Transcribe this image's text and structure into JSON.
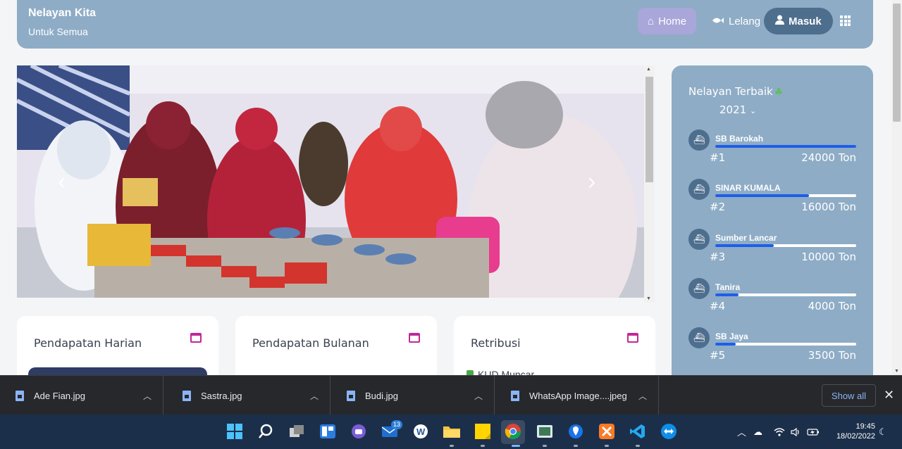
{
  "navbar": {
    "brand": "Nelayan Kita",
    "tagline": "Untuk Semua",
    "home": "Home",
    "lelang": "Lelang",
    "masuk": "Masuk"
  },
  "cards": [
    {
      "title": "Pendapatan Harian"
    },
    {
      "title": "Pendapatan Bulanan"
    },
    {
      "title": "Retribusi",
      "first_item": "KUD Muncar"
    }
  ],
  "ranking": {
    "title": "Nelayan Terbaik",
    "year": "2021",
    "items": [
      {
        "name": "SB Barokah",
        "rank": "#1",
        "value": "24000 Ton",
        "fraction": 1.0
      },
      {
        "name": "SINAR KUMALA",
        "rank": "#2",
        "value": "16000 Ton",
        "fraction": 0.667
      },
      {
        "name": "Sumber Lancar",
        "rank": "#3",
        "value": "10000 Ton",
        "fraction": 0.417
      },
      {
        "name": "Tanira",
        "rank": "#4",
        "value": "4000 Ton",
        "fraction": 0.167
      },
      {
        "name": "SB Jaya",
        "rank": "#5",
        "value": "3500 Ton",
        "fraction": 0.146
      }
    ]
  },
  "downloads": {
    "files": [
      "Ade Fian.jpg",
      "Sastra.jpg",
      "Budi.jpg",
      "WhatsApp Image....jpeg"
    ],
    "show_all": "Show all"
  },
  "taskbar": {
    "mail_badge": "13",
    "time": "19:45",
    "date": "18/02/2022"
  }
}
